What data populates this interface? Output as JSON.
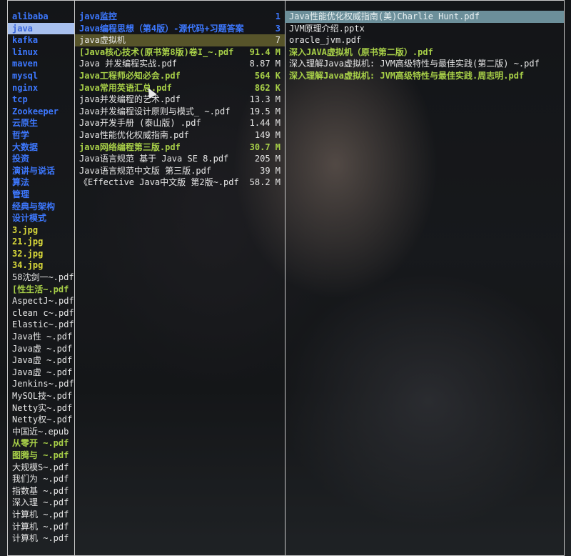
{
  "parent_column": {
    "items": [
      {
        "name": "alibaba",
        "kind": "dir"
      },
      {
        "name": "java",
        "kind": "dir",
        "selected": true
      },
      {
        "name": "kafka",
        "kind": "dir"
      },
      {
        "name": "linux",
        "kind": "dir"
      },
      {
        "name": "maven",
        "kind": "dir"
      },
      {
        "name": "mysql",
        "kind": "dir"
      },
      {
        "name": "nginx",
        "kind": "dir"
      },
      {
        "name": "tcp",
        "kind": "dir"
      },
      {
        "name": "Zookeeper",
        "kind": "dir"
      },
      {
        "name": "云原生",
        "kind": "dir"
      },
      {
        "name": "哲学",
        "kind": "dir"
      },
      {
        "name": "大数据",
        "kind": "dir"
      },
      {
        "name": "投资",
        "kind": "dir"
      },
      {
        "name": "演讲与说话",
        "kind": "dir"
      },
      {
        "name": "算法",
        "kind": "dir"
      },
      {
        "name": "管理",
        "kind": "dir"
      },
      {
        "name": "经典与架构",
        "kind": "dir"
      },
      {
        "name": "设计模式",
        "kind": "dir"
      },
      {
        "name": "3.jpg",
        "kind": "img"
      },
      {
        "name": "21.jpg",
        "kind": "img"
      },
      {
        "name": "32.jpg",
        "kind": "img"
      },
      {
        "name": "34.jpg",
        "kind": "img"
      },
      {
        "name": "58沈剑一~.pdf",
        "kind": "file"
      },
      {
        "name": "[性生活~.pdf",
        "kind": "green"
      },
      {
        "name": "AspectJ~.pdf",
        "kind": "file"
      },
      {
        "name": "clean c~.pdf",
        "kind": "file"
      },
      {
        "name": "Elastic~.pdf",
        "kind": "file"
      },
      {
        "name": "Java性 ~.pdf",
        "kind": "file"
      },
      {
        "name": "Java虚 ~.pdf",
        "kind": "file"
      },
      {
        "name": "Java虚 ~.pdf",
        "kind": "file"
      },
      {
        "name": "Java虚 ~.pdf",
        "kind": "file"
      },
      {
        "name": "Jenkins~.pdf",
        "kind": "file"
      },
      {
        "name": "MySQL技~.pdf",
        "kind": "file"
      },
      {
        "name": "Netty实~.pdf",
        "kind": "file"
      },
      {
        "name": "Netty权~.pdf",
        "kind": "file"
      },
      {
        "name": "中国近~.epub",
        "kind": "file"
      },
      {
        "name": "从零开 ~.pdf",
        "kind": "green"
      },
      {
        "name": "图腾与 ~.pdf",
        "kind": "green"
      },
      {
        "name": "大规模S~.pdf",
        "kind": "file"
      },
      {
        "name": "我们为 ~.pdf",
        "kind": "file"
      },
      {
        "name": "指数基 ~.pdf",
        "kind": "file"
      },
      {
        "name": "深入理 ~.pdf",
        "kind": "file"
      },
      {
        "name": "计算机 ~.pdf",
        "kind": "file"
      },
      {
        "name": "计算机 ~.pdf",
        "kind": "file"
      },
      {
        "name": "计算机 ~.pdf",
        "kind": "file"
      }
    ]
  },
  "current_column": {
    "items": [
      {
        "name": "java监控",
        "size": "1",
        "kind": "dir"
      },
      {
        "name": "Java编程思想（第4版）-源代码+习题答案",
        "size": "3",
        "kind": "dir"
      },
      {
        "name": "java虚拟机",
        "size": "7",
        "kind": "file",
        "selected": true
      },
      {
        "name": "[Java核心技术(原书第8版)卷I_~.pdf",
        "size": "91.4 M",
        "kind": "green"
      },
      {
        "name": "Java 并发编程实战.pdf",
        "size": "8.87 M",
        "kind": "file"
      },
      {
        "name": "Java工程师必知必会.pdf",
        "size": "564 K",
        "kind": "green"
      },
      {
        "name": "Java常用英语汇总.pdf",
        "size": "862 K",
        "kind": "green"
      },
      {
        "name": "java并发编程的艺术.pdf",
        "size": "13.3 M",
        "kind": "file"
      },
      {
        "name": "Java并发编程设计原则与模式_ ~.pdf",
        "size": "19.5 M",
        "kind": "file"
      },
      {
        "name": "Java开发手册 (泰山版) .pdf",
        "size": "1.44 M",
        "kind": "file"
      },
      {
        "name": "Java性能优化权威指南.pdf",
        "size": "149 M",
        "kind": "file"
      },
      {
        "name": "java网络编程第三版.pdf",
        "size": "30.7 M",
        "kind": "green"
      },
      {
        "name": "Java语言规范 基于 Java SE 8.pdf",
        "size": "205 M",
        "kind": "file"
      },
      {
        "name": "Java语言规范中文版 第三版.pdf",
        "size": "39 M",
        "kind": "file"
      },
      {
        "name": "《Effective Java中文版 第2版~.pdf",
        "size": "58.2 M",
        "kind": "file"
      }
    ]
  },
  "preview_column": {
    "items": [
      {
        "name": "Java性能优化权威指南(美)Charlie Hunt.pdf",
        "kind": "file",
        "selected": true
      },
      {
        "name": "JVM原理介绍.pptx",
        "kind": "file"
      },
      {
        "name": "oracle_jvm.pdf",
        "kind": "file"
      },
      {
        "name": "深入JAVA虚拟机（原书第二版）.pdf",
        "kind": "green"
      },
      {
        "name": "深入理解Java虚拟机: JVM高级特性与最佳实践(第二版) ~.pdf",
        "kind": "file"
      },
      {
        "name": "深入理解Java虚拟机: JVM高级特性与最佳实践.周志明.pdf",
        "kind": "green"
      }
    ]
  },
  "colors": {
    "dir": "#3d78ff",
    "image": "#d9d93a",
    "executable": "#a8d048",
    "file": "#e6e6e6",
    "border": "#c9c9c9"
  }
}
